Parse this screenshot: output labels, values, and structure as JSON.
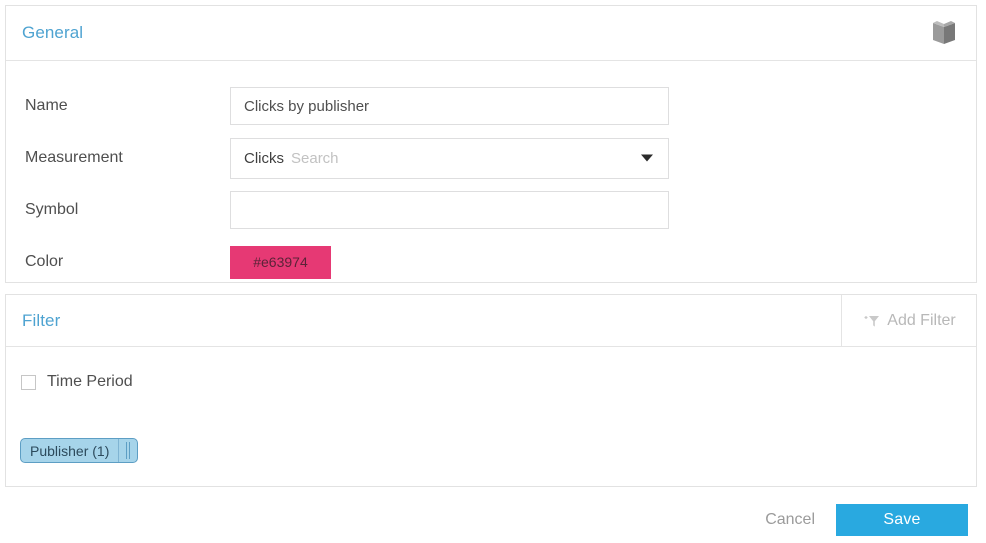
{
  "general": {
    "title": "General",
    "book_icon": "book-icon",
    "fields": {
      "name": {
        "label": "Name",
        "value": "Clicks by publisher",
        "placeholder": ""
      },
      "measurement": {
        "label": "Measurement",
        "value": "Clicks",
        "search_placeholder": "Search",
        "caret_icon": "chevron-down-icon"
      },
      "symbol": {
        "label": "Symbol",
        "value": "",
        "placeholder": ""
      },
      "color": {
        "label": "Color",
        "value": "#e63974",
        "swatch_hex": "#e63974"
      }
    }
  },
  "filter": {
    "title": "Filter",
    "add_filter_label": "Add Filter",
    "add_filter_icon": "add-funnel-icon",
    "time_period": {
      "label": "Time Period",
      "checked": false
    },
    "tags": [
      {
        "label": "Publisher (1)",
        "handle_icon": "drag-handle-icon"
      }
    ]
  },
  "footer": {
    "cancel_label": "Cancel",
    "save_label": "Save"
  },
  "colors": {
    "accent_blue": "#4ea3d1",
    "save_blue": "#29a9e0",
    "swatch_pink": "#e63974",
    "tag_blue": "#a6d4ea"
  }
}
